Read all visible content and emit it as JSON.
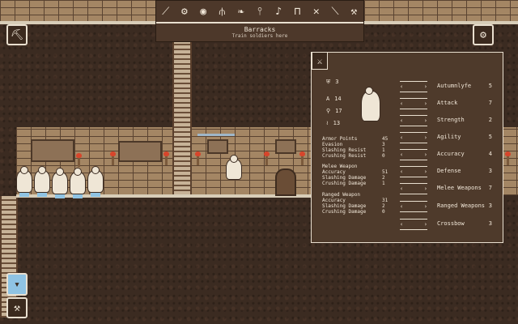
{
  "toolbar": {
    "icons": [
      "dig-icon",
      "gear-icon",
      "fish-icon",
      "fork-icon",
      "feather-icon",
      "spoon-icon",
      "bell-icon",
      "chair-icon",
      "cross-icon",
      "stick-icon",
      "wrench-icon"
    ],
    "title": "Barracks",
    "subtitle": "Train soldiers here"
  },
  "panel": {
    "stats": [
      {
        "icon": "shield-icon",
        "value": "3"
      },
      {
        "icon": "a-icon",
        "value": "14"
      },
      {
        "icon": "pin-icon",
        "value": "17"
      },
      {
        "icon": "bone-icon",
        "value": "13"
      }
    ],
    "attributes": [
      {
        "label": "Autumnlyfe",
        "value": "5"
      },
      {
        "label": "Attack",
        "value": "7"
      },
      {
        "label": "Strength",
        "value": "2"
      },
      {
        "label": "Agility",
        "value": "5"
      },
      {
        "label": "Accuracy",
        "value": "4"
      },
      {
        "label": "Defense",
        "value": "3"
      },
      {
        "label": "Melee Weapons",
        "value": "7"
      },
      {
        "label": "Ranged Weapons",
        "value": "3"
      },
      {
        "label": "Crossbow",
        "value": "3"
      }
    ],
    "combat": [
      {
        "label": "Armor Points",
        "value": "45"
      },
      {
        "label": "Evasion",
        "value": "3"
      },
      {
        "label": "Slashing Resist",
        "value": "1"
      },
      {
        "label": "Crushing Resist",
        "value": "0"
      },
      {
        "label": "Melee Weapon",
        "value": ""
      },
      {
        "label": "Accuracy",
        "value": "51"
      },
      {
        "label": "Slashing Damage",
        "value": "2"
      },
      {
        "label": "Crushing Damage",
        "value": "1"
      },
      {
        "label": "Ranged Weapon",
        "value": ""
      },
      {
        "label": "Accuracy",
        "value": "31"
      },
      {
        "label": "Slashing Damage",
        "value": "2"
      },
      {
        "label": "Crushing Damage",
        "value": "0"
      }
    ]
  },
  "colors": {
    "panel": "#4e3a2b",
    "border": "#e9dfcf",
    "torch": "#d7452b",
    "water": "#8fc3e3"
  }
}
